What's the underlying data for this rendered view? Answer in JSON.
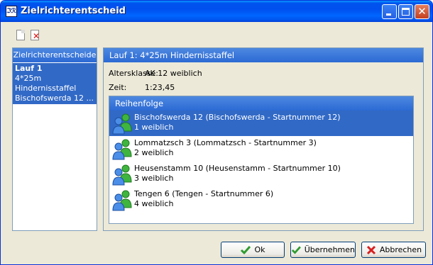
{
  "window": {
    "title": "Zielrichterentscheid",
    "icon_text": "ℑℛ"
  },
  "titlebar_buttons": {
    "close": "✕"
  },
  "toolbar": {
    "icons": [
      "new-document-icon",
      "delete-document-icon"
    ],
    "delete_glyph": "✕"
  },
  "left_panel": {
    "header": "Zielrichterentscheide",
    "items": [
      {
        "line1": "Lauf 1",
        "line2": "4*25m Hindernisstaffel",
        "line3": "Bischofswerda 12 ..."
      }
    ]
  },
  "right_panel": {
    "header": "Lauf 1: 4*25m Hindernisstaffel",
    "altersklasse_label": "Altersklasse:",
    "altersklasse_value": "AK 12 weiblich",
    "zeit_label": "Zeit:",
    "zeit_value": "1:23,45",
    "reihenfolge_header": "Reihenfolge",
    "entries": [
      {
        "title": "Bischofswerda 12 (Bischofswerda - Startnummer 12)",
        "subtitle": "1 weiblich"
      },
      {
        "title": "Lommatzsch 3 (Lommatzsch - Startnummer 3)",
        "subtitle": "2 weiblich"
      },
      {
        "title": "Heusenstamm 10 (Heusenstamm - Startnummer 10)",
        "subtitle": "3 weiblich"
      },
      {
        "title": "Tengen 6 (Tengen - Startnummer 6)",
        "subtitle": "4 weiblich"
      }
    ]
  },
  "buttons": {
    "ok": "Ok",
    "apply": "Übernehmen",
    "cancel": "Abbrechen"
  },
  "colors": {
    "selection": "#3169c6",
    "header": "#2c6ad4",
    "dialog_bg": "#ece9d8"
  }
}
